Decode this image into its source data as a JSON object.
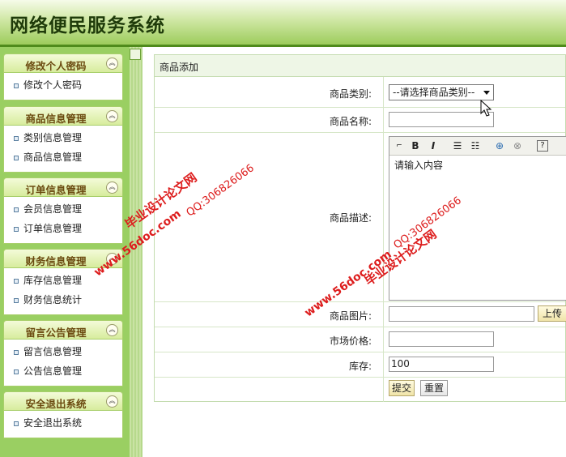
{
  "header": {
    "title": "网络便民服务系统"
  },
  "sidebar": {
    "groups": [
      {
        "title": "修改个人密码",
        "items": [
          "修改个人密码"
        ]
      },
      {
        "title": "商品信息管理",
        "items": [
          "类别信息管理",
          "商品信息管理"
        ]
      },
      {
        "title": "订单信息管理",
        "items": [
          "会员信息管理",
          "订单信息管理"
        ]
      },
      {
        "title": "财务信息管理",
        "items": [
          "库存信息管理",
          "财务信息统计"
        ]
      },
      {
        "title": "留言公告管理",
        "items": [
          "留言信息管理",
          "公告信息管理"
        ]
      },
      {
        "title": "安全退出系统",
        "items": [
          "安全退出系统"
        ]
      }
    ],
    "collapse_glyph": "≈"
  },
  "form": {
    "title": "商品添加",
    "category_label": "商品类别:",
    "category_selected": "--请选择商品类别--",
    "name_label": "商品名称:",
    "name_value": "",
    "desc_label": "商品描述:",
    "desc_content": "请输入内容",
    "image_label": "商品图片:",
    "image_value": "",
    "upload_button": "上传",
    "price_label": "市场价格:",
    "price_value": "",
    "stock_label": "库存:",
    "stock_value": "100",
    "submit_button": "提交",
    "reset_button": "重置"
  },
  "watermarks": {
    "brand": "毕业设计论文网",
    "site": "www.56doc.com",
    "qq": "QQ:306826066"
  },
  "colors": {
    "accent_green": "#4f8b1c",
    "sidebar_green": "#9acf62",
    "watermark_red": "#dd1d1d"
  }
}
